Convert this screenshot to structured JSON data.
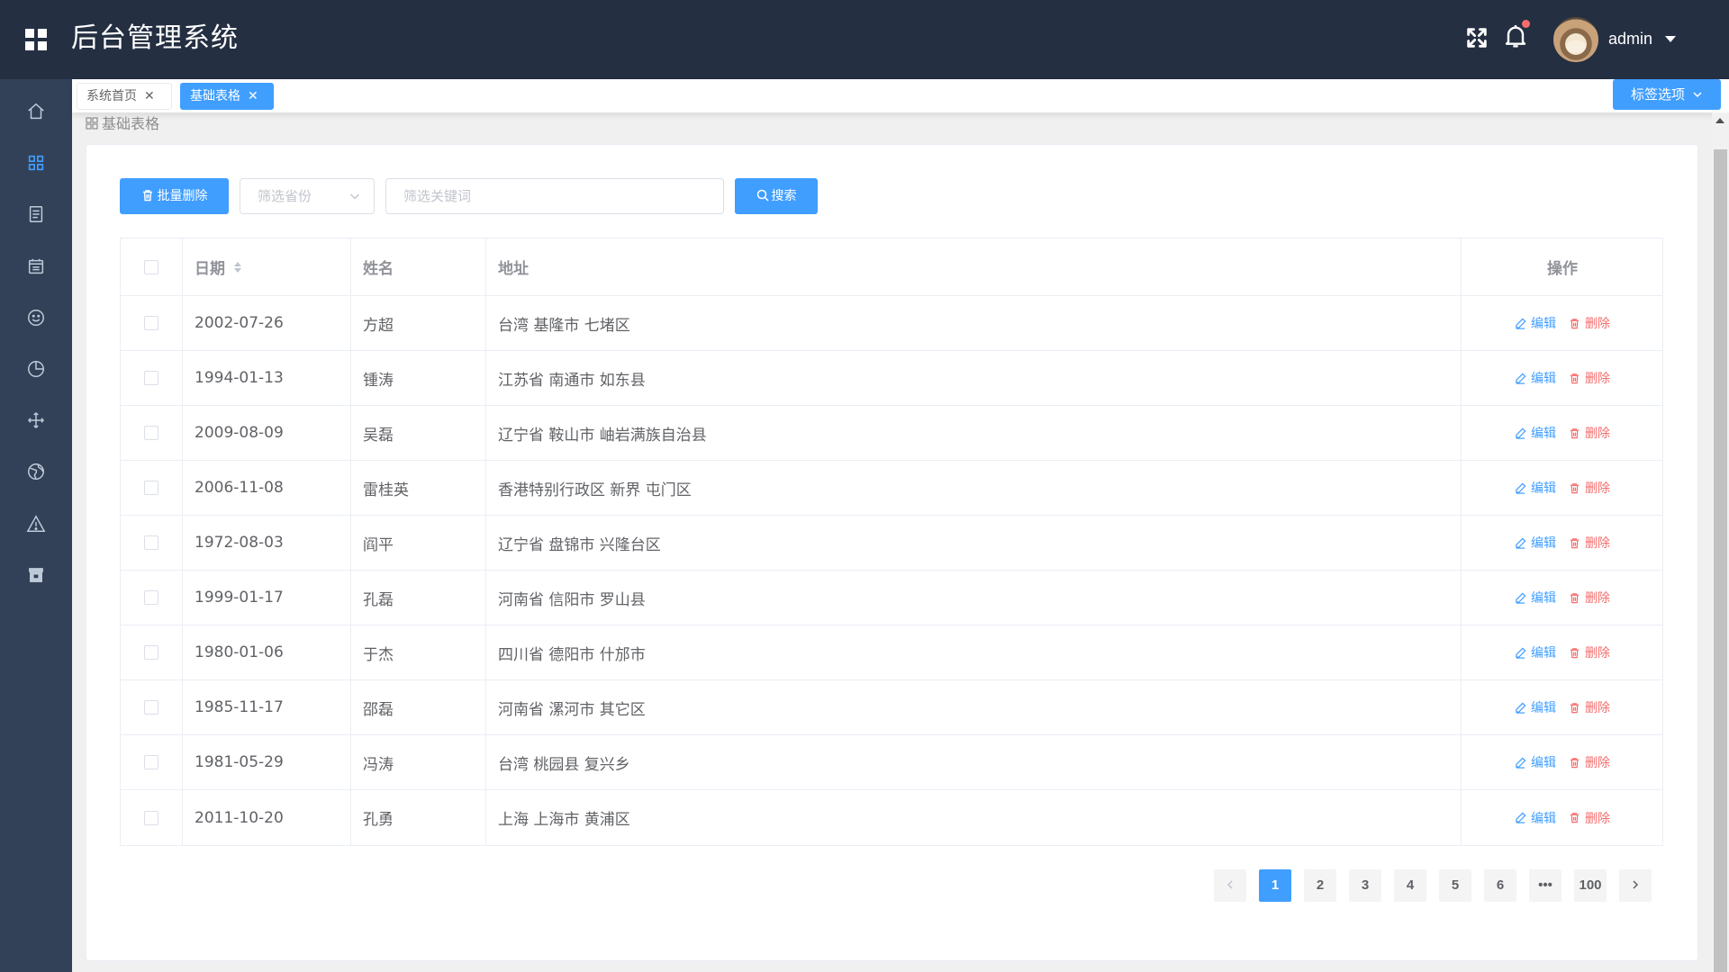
{
  "app": {
    "title": "后台管理系统"
  },
  "header": {
    "username": "admin"
  },
  "tags": [
    {
      "label": "系统首页",
      "close": "✕"
    },
    {
      "label": "基础表格",
      "close": "✕"
    }
  ],
  "tag_options": {
    "label": "标签选项"
  },
  "breadcrumb": {
    "label": "基础表格"
  },
  "toolbar": {
    "bulk_delete_label": "批量删除",
    "province_placeholder": "筛选省份",
    "keyword_placeholder": "筛选关键词",
    "search_label": "搜索"
  },
  "table": {
    "headers": {
      "date": "日期",
      "name": "姓名",
      "address": "地址",
      "action": "操作"
    },
    "edit_label": "编辑",
    "delete_label": "删除",
    "rows": [
      {
        "date": "2002-07-26",
        "name": "方超",
        "address": "台湾 基隆市 七堵区"
      },
      {
        "date": "1994-01-13",
        "name": "锺涛",
        "address": "江苏省 南通市 如东县"
      },
      {
        "date": "2009-08-09",
        "name": "吴磊",
        "address": "辽宁省 鞍山市 岫岩满族自治县"
      },
      {
        "date": "2006-11-08",
        "name": "雷桂英",
        "address": "香港特别行政区 新界 屯门区"
      },
      {
        "date": "1972-08-03",
        "name": "阎平",
        "address": "辽宁省 盘锦市 兴隆台区"
      },
      {
        "date": "1999-01-17",
        "name": "孔磊",
        "address": "河南省 信阳市 罗山县"
      },
      {
        "date": "1980-01-06",
        "name": "于杰",
        "address": "四川省 德阳市 什邡市"
      },
      {
        "date": "1985-11-17",
        "name": "邵磊",
        "address": "河南省 漯河市 其它区"
      },
      {
        "date": "1981-05-29",
        "name": "冯涛",
        "address": "台湾 桃园县 复兴乡"
      },
      {
        "date": "2011-10-20",
        "name": "孔勇",
        "address": "上海 上海市 黄浦区"
      }
    ]
  },
  "pagination": {
    "pages": [
      "1",
      "2",
      "3",
      "4",
      "5",
      "6",
      "•••",
      "100"
    ],
    "current": "1"
  },
  "colors": {
    "primary": "#409eff",
    "danger": "#f56c6c",
    "header_bg": "#242f42",
    "sidebar_bg": "#324157"
  },
  "sidebar_icons": [
    "home-icon",
    "grid-icon",
    "document-icon",
    "calendar-icon",
    "smile-icon",
    "pie-chart-icon",
    "move-icon",
    "globe-icon",
    "warning-icon",
    "archive-icon"
  ]
}
